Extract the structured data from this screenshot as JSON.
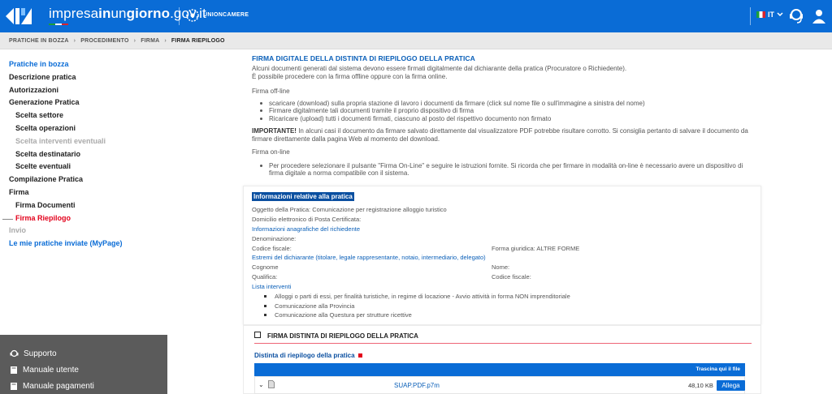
{
  "header": {
    "brand_light": "impresa",
    "brand_bold1": "in",
    "brand_mid": "un",
    "brand_bold2": "giorno",
    "brand_domain": ".gov.it",
    "partner": "UNIONCAMERE",
    "language": "IT"
  },
  "breadcrumb": [
    "PRATICHE IN BOZZA",
    "PROCEDIMENTO",
    "FIRMA",
    "FIRMA RIEPILOGO"
  ],
  "sidebar": {
    "items": [
      {
        "label": "Pratiche in bozza"
      },
      {
        "label": "Descrizione pratica"
      },
      {
        "label": "Autorizzazioni"
      },
      {
        "label": "Generazione Pratica"
      },
      {
        "label": "Scelta settore"
      },
      {
        "label": "Scelta operazioni"
      },
      {
        "label": "Scelta interventi eventuali"
      },
      {
        "label": "Scelta destinatario"
      },
      {
        "label": "Scelte eventuali"
      },
      {
        "label": "Compilazione Pratica"
      },
      {
        "label": "Firma"
      },
      {
        "label": "Firma Documenti"
      },
      {
        "label": "Firma Riepilogo"
      },
      {
        "label": "Invio"
      },
      {
        "label": "Le mie pratiche inviate (MyPage)"
      }
    ],
    "footer": [
      {
        "label": "Supporto",
        "icon": "support-icon"
      },
      {
        "label": "Manuale utente",
        "icon": "book-icon"
      },
      {
        "label": "Manuale pagamenti",
        "icon": "book-icon"
      }
    ]
  },
  "main": {
    "title": "FIRMA DIGITALE DELLA DISTINTA DI RIEPILOGO DELLA PRATICA",
    "intro1": "Alcuni documenti generati dal sistema devono essere firmati digitalmente dal dichiarante della pratica (Procuratore o Richiedente).",
    "intro2": "È possibile procedere con la firma offline oppure con la firma online.",
    "offline_title": "Firma off-line",
    "offline_bullets": [
      "scaricare (download) sulla propria stazione di lavoro i documenti da firmare (click sul nome file o sull'immagine a sinistra del nome)",
      "Firmare digitalmente tali documenti tramite il proprio dispositivo di firma",
      "Ricaricare (upload) tutti i documenti firmati, ciascuno al posto del rispettivo documento non firmato"
    ],
    "important_label": "IMPORTANTE!",
    "important_text": " In alcuni casi il documento da firmare salvato direttamente dal visualizzatore PDF potrebbe risultare corrotto. Si consiglia pertanto di salvare il documento da firmare direttamente dalla pagina Web al momento del download.",
    "online_title": "Firma on-line",
    "online_bullet": "Per procedere selezionare il pulsante \"Firma On-Line\" e seguire le istruzioni fornite. Si ricorda che per firmare in modalità on-line è necessario avere un dispositivo di firma digitale a norma compatibile con il sistema."
  },
  "info": {
    "heading": "Informazioni relative alla pratica",
    "oggetto": "Oggetto della Pratica:   Comunicazione per registrazione alloggio turistico",
    "domicilio": "Domicilio elettronico di Posta Certificata:",
    "anagrafiche": "Informazioni anagrafiche del richiedente",
    "denominazione": "Denominazione:",
    "codice_fiscale": "Codice fiscale:",
    "forma_giuridica": "Forma giuridica:   ALTRE FORME",
    "estremi": "Estremi del dichiarante (titolare, legale rappresentante, notaio, intermediario, delegato)",
    "cognome": "Cognome",
    "nome": "Nome:",
    "qualifica": "Qualifica:",
    "codice_fiscale2": "Codice fiscale:",
    "lista": "Lista interventi",
    "interventi": [
      "Alloggi o parti di essi, per finalità turistiche, in regime di locazione - Avvio attività in forma NON imprenditoriale",
      "Comunicazione alla Provincia",
      "Comunicazione alla Questura per strutture ricettive"
    ]
  },
  "sign": {
    "title": "FIRMA DISTINTA DI RIEPILOGO DELLA PRATICA",
    "distinta_label": "Distinta di riepilogo della pratica",
    "drop_hint": "Trascina qui il file",
    "file_name": "SUAP.PDF.p7m",
    "file_size": "48,10 KB",
    "attach_label": "Allega"
  }
}
